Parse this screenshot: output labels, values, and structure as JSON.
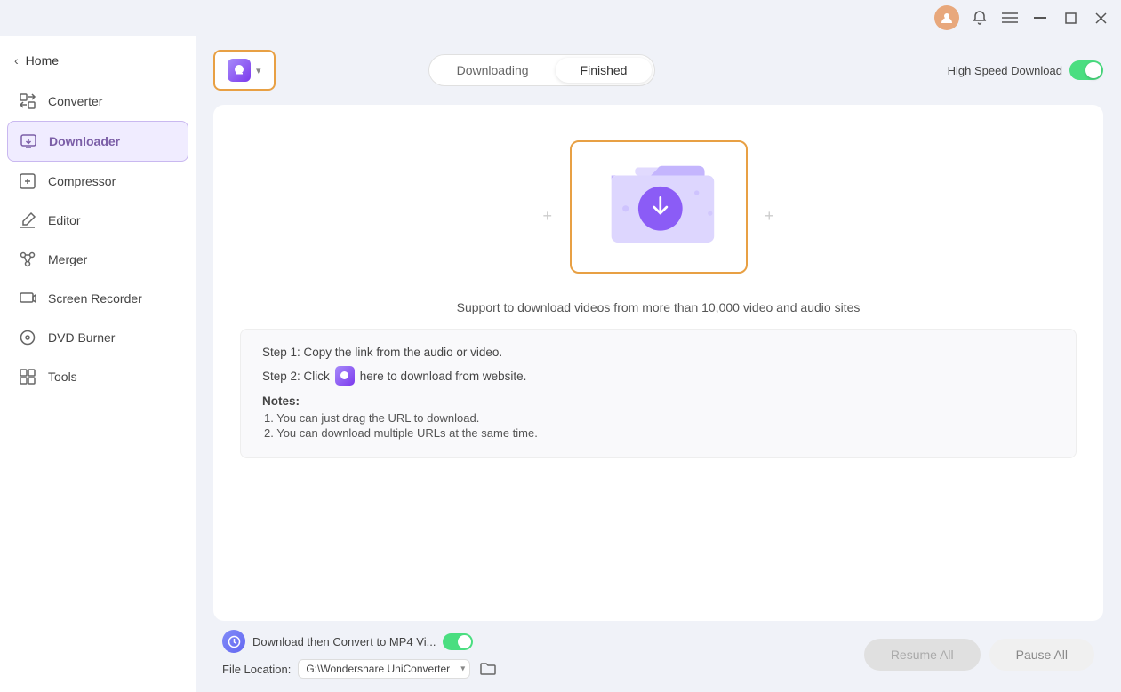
{
  "titlebar": {
    "user_icon_text": "U",
    "user_icon_color": "#e8a87c"
  },
  "sidebar": {
    "back_label": "Home",
    "items": [
      {
        "id": "converter",
        "label": "Converter",
        "icon": "converter-icon"
      },
      {
        "id": "downloader",
        "label": "Downloader",
        "icon": "downloader-icon",
        "active": true
      },
      {
        "id": "compressor",
        "label": "Compressor",
        "icon": "compressor-icon"
      },
      {
        "id": "editor",
        "label": "Editor",
        "icon": "editor-icon"
      },
      {
        "id": "merger",
        "label": "Merger",
        "icon": "merger-icon"
      },
      {
        "id": "screen-recorder",
        "label": "Screen Recorder",
        "icon": "screen-recorder-icon"
      },
      {
        "id": "dvd-burner",
        "label": "DVD Burner",
        "icon": "dvd-burner-icon"
      },
      {
        "id": "tools",
        "label": "Tools",
        "icon": "tools-icon"
      }
    ]
  },
  "topbar": {
    "add_button_label": "",
    "tabs": [
      {
        "id": "downloading",
        "label": "Downloading",
        "active": false
      },
      {
        "id": "finished",
        "label": "Finished",
        "active": true
      }
    ],
    "high_speed_label": "High Speed Download",
    "toggle_on": true
  },
  "content": {
    "support_text": "Support to download videos from more than 10,000 video and audio sites",
    "step1": "Step 1: Copy the link from the audio or video.",
    "step2_prefix": "Step 2: Click",
    "step2_suffix": "here to download from website.",
    "notes_title": "Notes:",
    "note1": "1. You can just drag the URL to download.",
    "note2": "2. You can download multiple URLs at the same time."
  },
  "bottom": {
    "convert_label": "Download then Convert to MP4 Vi...",
    "file_location_label": "File Location:",
    "file_location_value": "G:\\Wondershare UniConverter",
    "resume_label": "Resume All",
    "pause_label": "Pause All"
  }
}
